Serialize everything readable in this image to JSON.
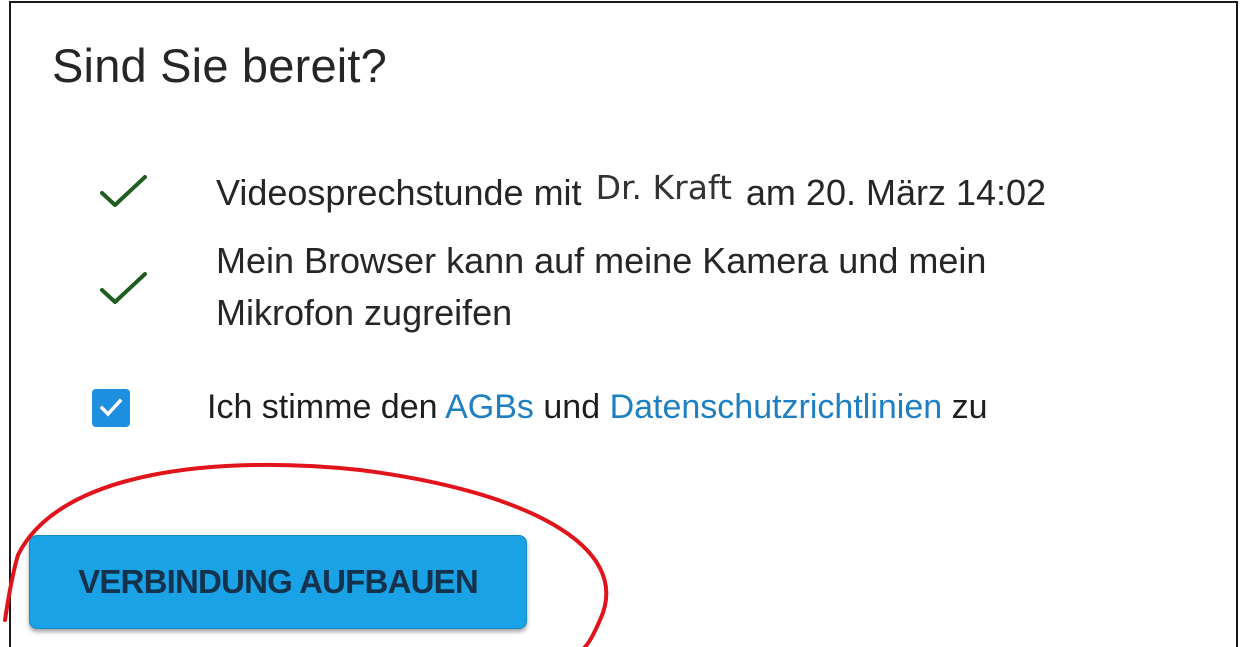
{
  "heading": "Sind Sie bereit?",
  "checks": [
    {
      "icon": "checkmark-icon",
      "text_before": "Videosprechstunde mit",
      "doctor": "Dr. Kraft",
      "text_after": "am 20. März 14:02"
    },
    {
      "icon": "checkmark-icon",
      "line1": "Mein Browser kann auf meine Kamera und mein",
      "line2": "Mikrofon zugreifen"
    }
  ],
  "consent": {
    "checked": true,
    "prefix": "Ich stimme den",
    "terms_link": "AGBs",
    "and": "und",
    "privacy_link": "Datenschutzrichtlinien",
    "suffix": "zu"
  },
  "connect_button": "VERBINDUNG AUFBAUEN",
  "colors": {
    "checkmark": "#1f5c1f",
    "checkbox": "#1e8fe0",
    "link": "#1e7fc2",
    "button": "#1aa2e6",
    "highlight_circle": "#e0141a"
  }
}
